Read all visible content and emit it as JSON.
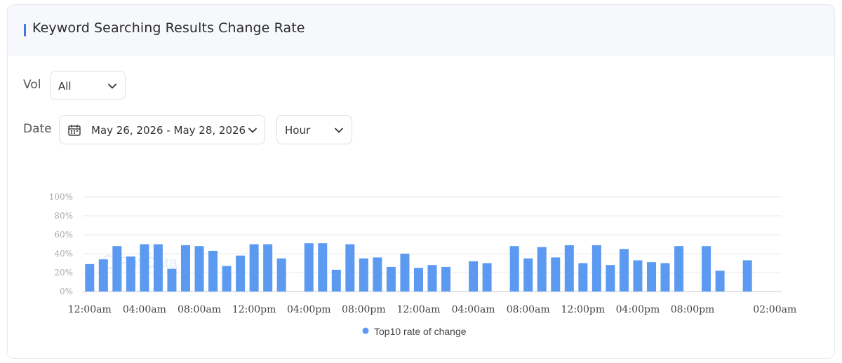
{
  "header": {
    "title": "Keyword Searching Results Change Rate"
  },
  "filters": {
    "vol_label": "Vol",
    "vol_value": "All",
    "date_label": "Date",
    "date_range": "May 26, 2026 - May 28, 2026",
    "granularity": "Hour"
  },
  "icons": {
    "calendar": "calendar-icon",
    "chevron": "chevron-down-icon",
    "legend_dot": "circle"
  },
  "colors": {
    "bar": "#5b9af0",
    "accent": "#3d78e6",
    "grid": "#e8e8e8",
    "axis": "#c8c8c8"
  },
  "watermark": "FoxData",
  "chart_data": {
    "type": "bar",
    "series": [
      {
        "name": "Top10 rate of change",
        "values": [
          29,
          34,
          48,
          37,
          50,
          50,
          24,
          49,
          48,
          43,
          27,
          38,
          50,
          50,
          35,
          null,
          51,
          51,
          23,
          50,
          35,
          36,
          26,
          40,
          25,
          28,
          26,
          null,
          32,
          30,
          null,
          48,
          35,
          47,
          36,
          49,
          30,
          49,
          28,
          45,
          33,
          31,
          30,
          48,
          null,
          48,
          22,
          null,
          33
        ]
      }
    ],
    "x_tick_labels": [
      "12:00am",
      "04:00am",
      "08:00am",
      "12:00pm",
      "04:00pm",
      "08:00pm",
      "12:00am",
      "04:00am",
      "08:00am",
      "12:00pm",
      "04:00pm",
      "08:00pm",
      "02:00am"
    ],
    "x_tick_positions": [
      0,
      4,
      8,
      12,
      16,
      20,
      24,
      28,
      32,
      36,
      40,
      44,
      50
    ],
    "y_tick_labels": [
      "0%",
      "20%",
      "40%",
      "60%",
      "80%",
      "100%"
    ],
    "ylim": [
      0,
      100
    ],
    "grid": true,
    "legend_position": "bottom-center",
    "xlabel": "",
    "ylabel": ""
  }
}
